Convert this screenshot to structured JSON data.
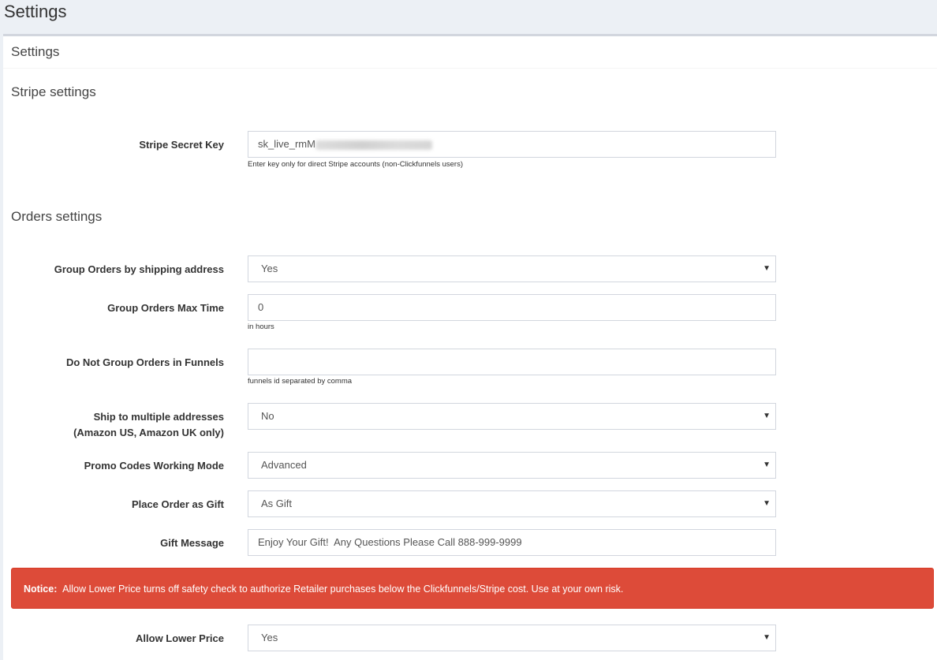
{
  "page": {
    "title": "Settings"
  },
  "box": {
    "title": "Settings"
  },
  "stripe": {
    "section_title": "Stripe settings",
    "secret_key": {
      "label": "Stripe Secret Key",
      "value_visible": "sk_live_rmM",
      "help": "Enter key only for direct Stripe accounts (non-Clickfunnels users)"
    }
  },
  "orders": {
    "section_title": "Orders settings",
    "group_by_address": {
      "label": "Group Orders by shipping address",
      "value": "Yes"
    },
    "group_max_time": {
      "label": "Group Orders Max Time",
      "value": "0",
      "help": "in hours"
    },
    "no_group_funnels": {
      "label": "Do Not Group Orders in Funnels",
      "value": "",
      "help": "funnels id separated by comma"
    },
    "ship_multiple": {
      "label_line1": "Ship to multiple addresses",
      "label_line2": "(Amazon US, Amazon UK only)",
      "value": "No"
    },
    "promo_mode": {
      "label": "Promo Codes Working Mode",
      "value": "Advanced"
    },
    "gift": {
      "label": "Place Order as Gift",
      "value": "As Gift"
    },
    "gift_message": {
      "label": "Gift Message",
      "value": "Enjoy Your Gift!  Any Questions Please Call 888-999-9999"
    },
    "notice": {
      "prefix": "Notice:",
      "text": "Allow Lower Price turns off safety check to authorize Retailer purchases below the Clickfunnels/Stripe cost. Use at your own risk."
    },
    "lower_price": {
      "label": "Allow Lower Price",
      "value": "Yes"
    }
  },
  "icons": {
    "caret": "caret-down-icon"
  },
  "colors": {
    "notice_bg": "#dd4b39",
    "page_bg": "#ecf0f5",
    "box_border": "#d2d6de"
  }
}
